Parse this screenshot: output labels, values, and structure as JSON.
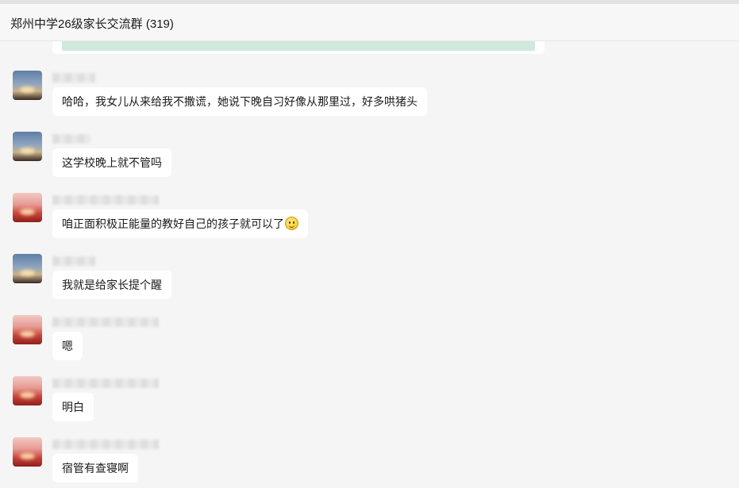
{
  "window": {
    "title": "郑州中学26级家长交流群 (319)"
  },
  "messages": [
    {
      "avatar": "blue",
      "text": "哈哈，我女儿从来给我不撒谎，她说下晚自习好像从那里过，好多哄猪头"
    },
    {
      "avatar": "blue",
      "text": "这学校晚上就不管吗"
    },
    {
      "avatar": "red",
      "text": "咱正面积极正能量的教好自己的孩子就可以了",
      "emoji": "smile-emoji"
    },
    {
      "avatar": "blue",
      "text": "我就是给家长提个醒"
    },
    {
      "avatar": "red",
      "text": "嗯"
    },
    {
      "avatar": "red",
      "text": "明白"
    },
    {
      "avatar": "red",
      "text": "宿管有查寝啊"
    }
  ]
}
